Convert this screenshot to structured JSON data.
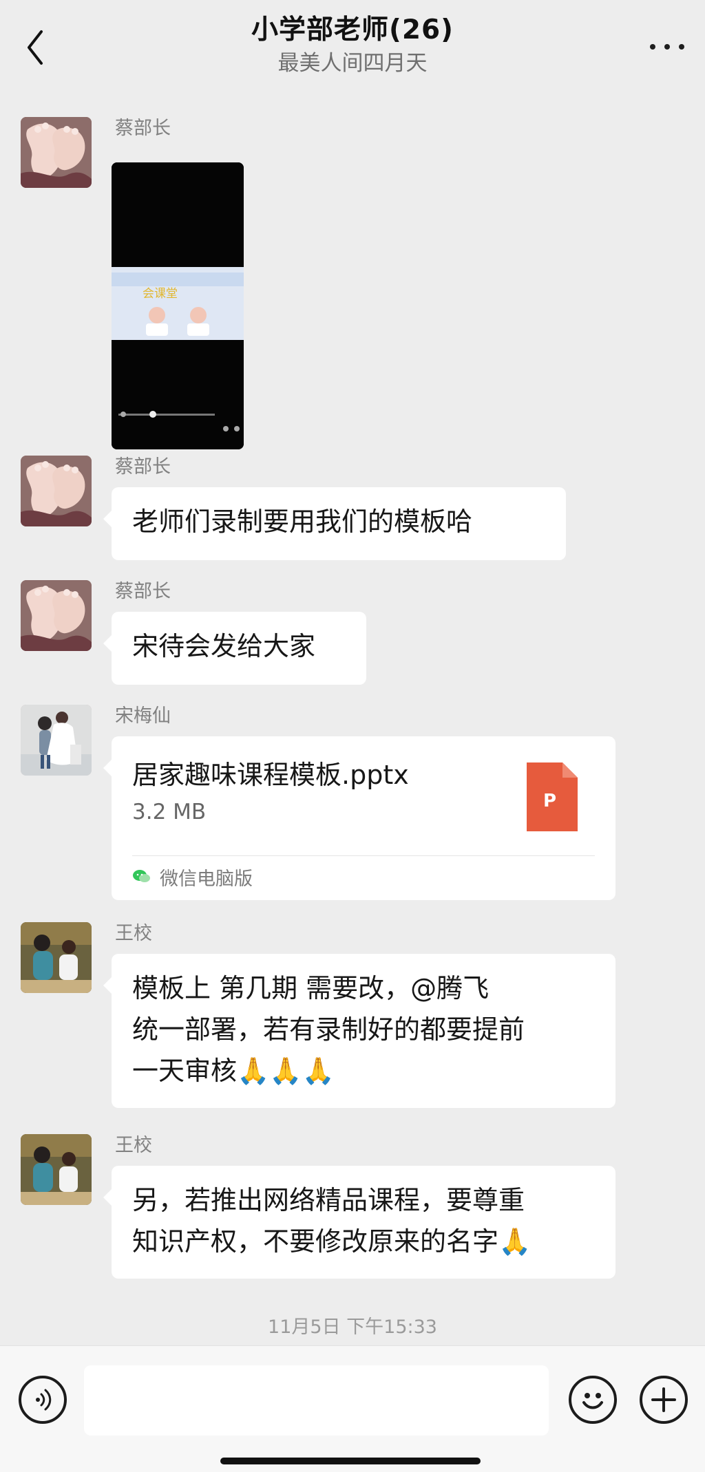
{
  "header": {
    "title": "小学部老师(26)",
    "subtitle": "最美人间四月天"
  },
  "messages": [
    {
      "sender": "蔡部长",
      "type": "video"
    },
    {
      "sender": "蔡部长",
      "text": "老师们录制要用我们的模板哈"
    },
    {
      "sender": "蔡部长",
      "text": "宋待会发给大家"
    },
    {
      "sender": "宋梅仙",
      "type": "file",
      "file": {
        "name": "居家趣味课程模板.pptx",
        "size": "3.2 MB",
        "source": "微信电脑版",
        "icon_letter": "P"
      }
    },
    {
      "sender": "王校",
      "lines": [
        "模板上  第几期  需要改，@腾飞",
        "统一部署，若有录制好的都要提前",
        "一天审核🙏🙏🙏"
      ]
    },
    {
      "sender": "王校",
      "lines": [
        "另，若推出网络精品课程，要尊重",
        "知识产权，不要修改原来的名字🙏"
      ]
    }
  ],
  "timestamp": "11月5日 下午15:33",
  "composer": {
    "value": "",
    "placeholder": ""
  },
  "icons": {
    "back": "chevron-left-icon",
    "more": "more-icon",
    "voice": "voice-icon",
    "emoji": "emoji-icon",
    "plus": "plus-icon",
    "file": "pptx-file-icon",
    "wechat_source": "wechat-icon"
  },
  "colors": {
    "background": "#ededed",
    "bubble": "#ffffff",
    "pptx_icon": "#e65b3d"
  }
}
